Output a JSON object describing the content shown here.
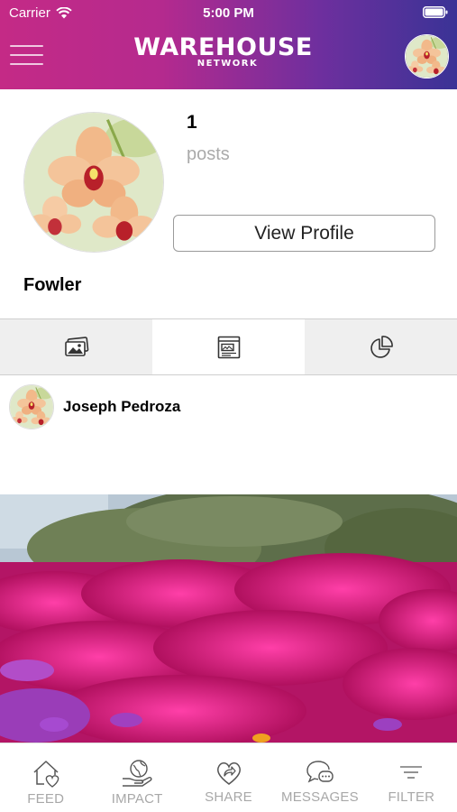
{
  "status_bar": {
    "carrier": "Carrier",
    "time": "5:00 PM"
  },
  "header": {
    "brand_name": "WAREHOUSE",
    "brand_sub": "NETWORK",
    "menu_icon": "hamburger-menu-icon",
    "avatar": "orchid-photo"
  },
  "profile": {
    "posts_count": "1",
    "posts_label": "posts",
    "view_profile_label": "View Profile",
    "name": "Fowler"
  },
  "tabs": [
    {
      "icon": "photos-icon",
      "selected": false
    },
    {
      "icon": "browser-window-icon",
      "selected": true
    },
    {
      "icon": "pie-chart-icon",
      "selected": false
    }
  ],
  "post": {
    "author": "Joseph Pedroza",
    "image": "magenta-flowers-photo"
  },
  "bottom_nav": [
    {
      "label": "FEED",
      "icon": "home-heart-icon"
    },
    {
      "label": "IMPACT",
      "icon": "hand-globe-icon"
    },
    {
      "label": "SHARE",
      "icon": "heart-share-icon"
    },
    {
      "label": "MESSAGES",
      "icon": "chat-bubbles-icon"
    },
    {
      "label": "FILTER",
      "icon": "filter-icon"
    }
  ],
  "colors": {
    "header_gradient_start": "#c42a86",
    "header_gradient_end": "#3a3396",
    "nav_label": "#a8a8a8"
  }
}
